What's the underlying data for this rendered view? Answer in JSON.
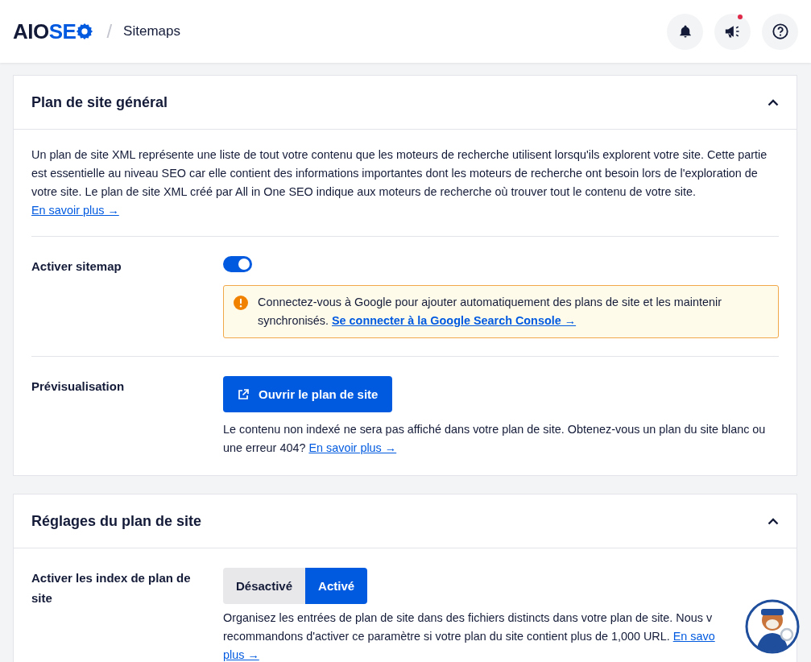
{
  "header": {
    "logo": {
      "dark": "AIO",
      "accent": "SE"
    },
    "separator": "/",
    "page": "Sitemaps",
    "actions": [
      {
        "kind": "bell",
        "has_new": false
      },
      {
        "kind": "megaphone",
        "has_new": true
      },
      {
        "kind": "help",
        "has_new": false
      }
    ]
  },
  "sections": [
    {
      "title": "Plan de site général",
      "expanded": true,
      "intro": {
        "text": "Un plan de site XML représente une liste de tout votre contenu que les moteurs de recherche utilisent lorsqu'ils explorent votre site. Cette partie est essentielle au niveau SEO car elle contient des informations importantes dont les moteurs de recherche ont besoin lors de l'exploration de votre site. Le plan de site XML créé par All in One SEO indique aux moteurs de recherche où trouver tout le contenu de votre site.",
        "link": "En savoir plus →"
      },
      "rows": [
        {
          "kind": "toggle",
          "label": "Activer sitemap",
          "on": true,
          "notice": {
            "text": "Connectez-vous à Google pour ajouter automatiquement des plans de site et les maintenir synchronisés.",
            "link": "Se connecter à la Google Search Console →"
          }
        },
        {
          "kind": "button",
          "label": "Prévisualisation",
          "button": "Ouvrir le plan de site",
          "help": {
            "text": "Le contenu non indexé ne sera pas affiché dans votre plan de site. Obtenez-vous un plan du site blanc ou une erreur 404?",
            "link": "En savoir plus →"
          }
        }
      ]
    },
    {
      "title": "Réglages du plan de site",
      "expanded": true,
      "rows": [
        {
          "kind": "segmented",
          "label": "Activer les index de plan de site",
          "options": [
            {
              "label": "Désactivé",
              "selected": false
            },
            {
              "label": "Activé",
              "selected": true
            }
          ],
          "help_lines": [
            {
              "text": "Organisez les entrées de plan de site dans des fichiers distincts dans votre plan de site. Nous v"
            },
            {
              "text": "recommandons d'activer ce paramètre si votre plan du site contient plus de 1,000 URL.",
              "link": "En savo"
            },
            {
              "link": "plus →"
            }
          ]
        }
      ]
    }
  ]
}
